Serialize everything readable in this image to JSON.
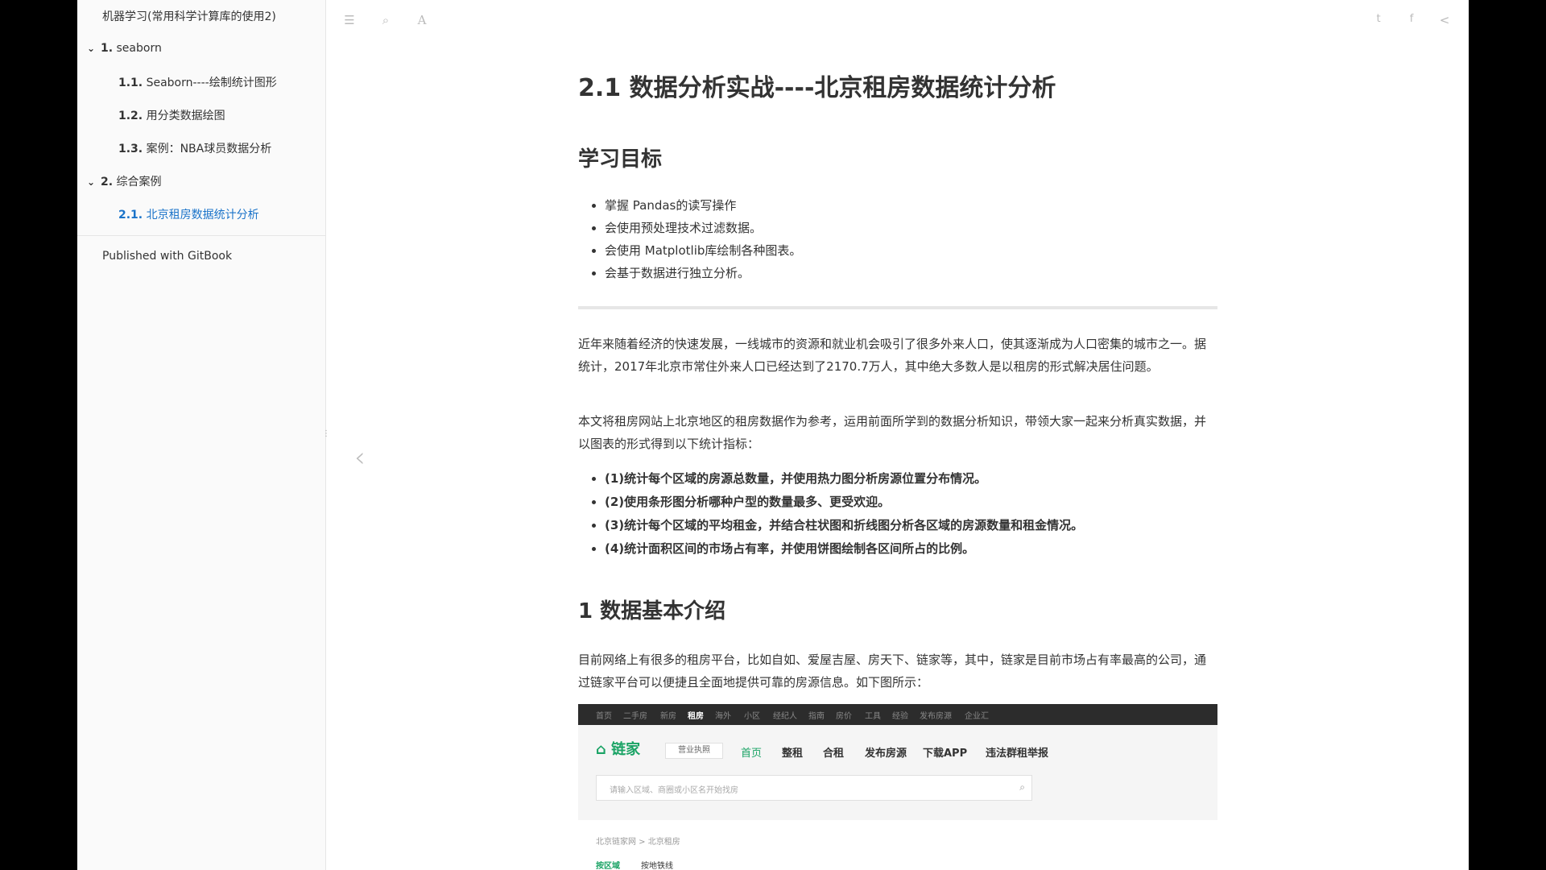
{
  "sidebar": {
    "book_title": "机器学习(常用科学计算库的使用2)",
    "items": [
      {
        "num": "1.",
        "label": "seaborn"
      },
      {
        "num": "1.1.",
        "label": "Seaborn----绘制统计图形"
      },
      {
        "num": "1.2.",
        "label": "用分类数据绘图"
      },
      {
        "num": "1.3.",
        "label": "案例：NBA球员数据分析"
      },
      {
        "num": "2.",
        "label": "综合案例"
      },
      {
        "num": "2.1.",
        "label": "北京租房数据统计分析"
      }
    ],
    "published": "Published with GitBook"
  },
  "toolbar": {
    "menu_icon": "☰",
    "search_icon": "⌕",
    "font_icon": "A",
    "twitter_icon": "t",
    "facebook_icon": "f",
    "share_icon": "<"
  },
  "nav": {
    "prev_arrow": "‹"
  },
  "page": {
    "title": "2.1 数据分析实战----北京租房数据统计分析",
    "goals_heading": "学习目标",
    "goals": [
      "掌握 Pandas的读写操作",
      "会使用预处理技术过滤数据。",
      "会使用 Matplotlib库绘制各种图表。",
      "会基于数据进行独立分析。"
    ],
    "intro_para1": "近年来随着经济的快速发展，一线城市的资源和就业机会吸引了很多外来人口，使其逐渐成为人口密集的城市之一。据统计，2017年北京市常住外来人口已经达到了2170.7万人，其中绝大多数人是以租房的形式解决居住问题。",
    "intro_para2": "本文将租房网站上北京地区的租房数据作为参考，运用前面所学到的数据分析知识，带领大家一起来分析真实数据，并以图表的形式得到以下统计指标：",
    "indicators": [
      "(1)统计每个区域的房源总数量，并使用热力图分析房源位置分布情况。",
      "(2)使用条形图分析哪种户型的数量最多、更受欢迎。",
      "(3)统计每个区域的平均租金，并结合柱状图和折线图分析各区域的房源数量和租金情况。",
      "(4)统计面积区间的市场占有率，并使用饼图绘制各区间所占的比例。"
    ],
    "section1_heading": "1 数据基本介绍",
    "section1_para": "目前网络上有很多的租房平台，比如自如、爱屋吉屋、房天下、链家等，其中，链家是目前市场占有率最高的公司，通过链家平台可以便捷且全面地提供可靠的房源信息。如下图所示："
  },
  "embedded": {
    "top_nav": [
      "首页",
      "二手房",
      "新房",
      "租房",
      "海外",
      "小区",
      "经纪人",
      "指南",
      "房价",
      "工具",
      "经验",
      "发布房源",
      "企业汇"
    ],
    "logo": "链家",
    "license": "营业执照",
    "main_nav": [
      "首页",
      "整租",
      "合租",
      "发布房源",
      "下载APP",
      "违法群租举报"
    ],
    "search_placeholder": "请输入区域、商圈或小区名开始找房",
    "breadcrumb": "北京链家网 > 北京租房",
    "filter_1": "按区域",
    "filter_2": "按地铁线"
  }
}
